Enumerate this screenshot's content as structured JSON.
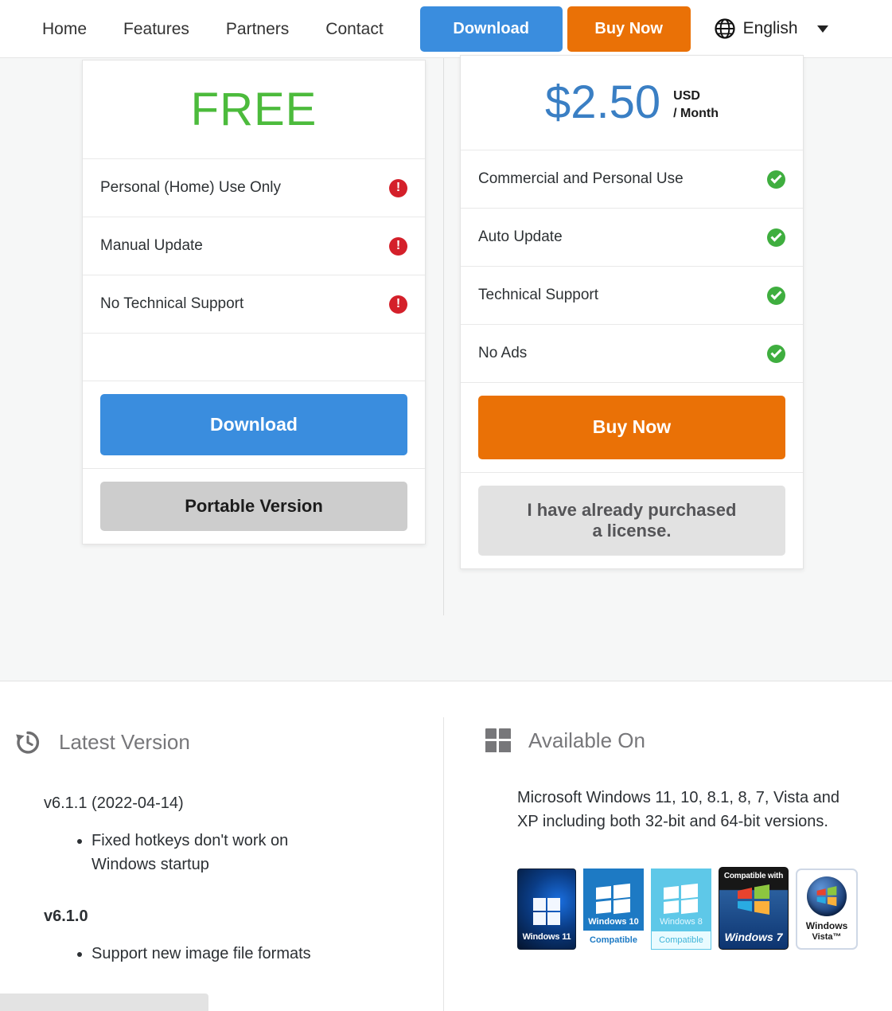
{
  "nav": {
    "links": [
      {
        "label": "Home",
        "name": "nav-link-home"
      },
      {
        "label": "Features",
        "name": "nav-link-features"
      },
      {
        "label": "Partners",
        "name": "nav-link-partners"
      },
      {
        "label": "Contact",
        "name": "nav-link-contact"
      }
    ],
    "download_label": "Download",
    "buy_label": "Buy Now",
    "language": "English",
    "globe_icon": "globe-icon",
    "caret_icon": "chevron-down-icon",
    "download_color": "#3a8dde",
    "buy_color": "#ea7106"
  },
  "pricing": {
    "free_card": {
      "headline": "FREE",
      "headline_color": "#4cbb3c",
      "features": [
        {
          "label": "Personal (Home) Use Only",
          "icon": "exclamation-circle-icon",
          "state": "unavailable"
        },
        {
          "label": "Manual Update",
          "icon": "exclamation-circle-icon",
          "state": "unavailable"
        },
        {
          "label": "No Technical Support",
          "icon": "exclamation-circle-icon",
          "state": "unavailable"
        }
      ],
      "primary_button": "Download",
      "secondary_button": "Portable Version"
    },
    "paid_card": {
      "price": "$2.50",
      "price_color": "#3a7fc4",
      "currency": "USD",
      "period": "/ Month",
      "features": [
        {
          "label": "Commercial and Personal Use",
          "icon": "check-circle-icon",
          "state": "available"
        },
        {
          "label": "Auto Update",
          "icon": "check-circle-icon",
          "state": "available"
        },
        {
          "label": "Technical Support",
          "icon": "check-circle-icon",
          "state": "available"
        },
        {
          "label": "No Ads",
          "icon": "check-circle-icon",
          "state": "available"
        }
      ],
      "primary_button": "Buy Now",
      "secondary_button": "I have already purchased a license.",
      "secondary_button_line1": "I have already purchased",
      "secondary_button_line2": "a license."
    }
  },
  "latest_version": {
    "icon": "history-clock-icon",
    "title": "Latest Version",
    "releases": [
      {
        "version": "v6.1.1 (2022-04-14)",
        "bold": false,
        "notes": [
          "Fixed hotkeys don't work on Windows startup"
        ]
      },
      {
        "version": "v6.1.0",
        "bold": true,
        "notes": [
          "Support new image file formats"
        ]
      }
    ]
  },
  "available_on": {
    "icon": "windows-logo-icon",
    "title": "Available On",
    "description": "Microsoft Windows 11, 10, 8.1, 8, 7, Vista and XP including both 32-bit and 64-bit versions.",
    "badges": [
      {
        "name": "windows-11-badge",
        "label": "Windows 11",
        "sub": ""
      },
      {
        "name": "windows-10-badge",
        "label": "Windows 10",
        "sub": "Compatible"
      },
      {
        "name": "windows-8-badge",
        "label": "Windows 8",
        "sub": "Compatible"
      },
      {
        "name": "windows-7-badge",
        "label": "Windows 7",
        "sub": "Compatible with"
      },
      {
        "name": "windows-vista-badge",
        "label": "Windows",
        "sub": "Vista™"
      }
    ]
  },
  "status_bar": {
    "text": ""
  }
}
